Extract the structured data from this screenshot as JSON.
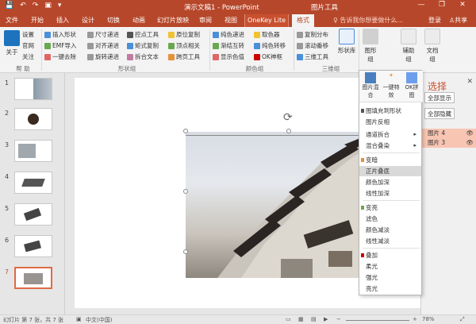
{
  "titlebar": {
    "title": "演示文稿1 - PowerPoint",
    "context": "图片工具",
    "min": "—",
    "restore": "❐",
    "close": "✕"
  },
  "tabs": {
    "file": "文件",
    "home": "开始",
    "insert": "插入",
    "design": "设计",
    "transitions": "切换",
    "animations": "动画",
    "slideshow": "幻灯片放映",
    "review": "审阅",
    "view": "视图",
    "onekey": "OneKey Lite",
    "format": "格式",
    "tellme": "告诉我你想要做什么...",
    "login": "登录",
    "share": "共享"
  },
  "ribbon": {
    "help": {
      "about": "关于",
      "settings": "设置",
      "site": "官网",
      "follow": "关注",
      "label": "帮 助"
    },
    "shape": {
      "insert_shape": "插入形状",
      "emf_import": "EMF导入",
      "one_key_remove": "一键去除",
      "size_increment": "尺寸递进",
      "align_increment": "对齐递进",
      "rotate_increment": "旋转递进",
      "control_tool": "控点工具",
      "matrix_copy": "矩式复制",
      "split_text": "拆合文本",
      "original_position": "原位复制",
      "vertex_related": "顶点相关",
      "page_tool": "跨页工具",
      "label": "形状组"
    },
    "color": {
      "pure_fill": "纯色递进",
      "gradient_swap": "渐结互转",
      "display_color": "显示色值",
      "picker": "取色器",
      "color_transform": "纯色转移",
      "ok_shenqi": "OK神框",
      "label": "颜色组"
    },
    "three_d": {
      "copy_distribute": "复制分布",
      "scroll_flip": "滚动番移",
      "three_d_rotate": "三维工具",
      "shape_lib": "形状库",
      "label": "三维组"
    },
    "right": {
      "shape_group": "图形组",
      "assist_group": "辅助组",
      "doc_group": "文档组"
    }
  },
  "thumbnails": [
    {
      "num": "1"
    },
    {
      "num": "2"
    },
    {
      "num": "3"
    },
    {
      "num": "4"
    },
    {
      "num": "5"
    },
    {
      "num": "6"
    },
    {
      "num": "7"
    }
  ],
  "dropdown": {
    "top_buttons": [
      "图片混合",
      "一键特效",
      "OK拼图"
    ],
    "items": [
      {
        "label": "图填充到形状"
      },
      {
        "label": "图片反相"
      },
      {
        "label": "通道拆合",
        "submenu": true
      },
      {
        "label": "混合叠染",
        "submenu": true
      },
      {
        "label": "变暗"
      },
      {
        "label": "正片叠底",
        "highlight": true
      },
      {
        "label": "颜色加深"
      },
      {
        "label": "线性加深"
      },
      {
        "label": "变亮"
      },
      {
        "label": "滤色"
      },
      {
        "label": "颜色减淡"
      },
      {
        "label": "线性减淡"
      },
      {
        "label": "叠加"
      },
      {
        "label": "柔光"
      },
      {
        "label": "强光"
      },
      {
        "label": "亮光"
      }
    ]
  },
  "right_pane": {
    "title": "选择",
    "show_all": "全部显示",
    "hide_all": "全部隐藏",
    "layers": [
      "图片 4",
      "图片 3"
    ]
  },
  "status": {
    "slide_info": "幻灯片 第 7 张，共 7 张",
    "lang": "中文(中国)",
    "zoom": "78%"
  },
  "colors": {
    "accent": "#b7472a",
    "highlight": "#f8c5b2"
  }
}
